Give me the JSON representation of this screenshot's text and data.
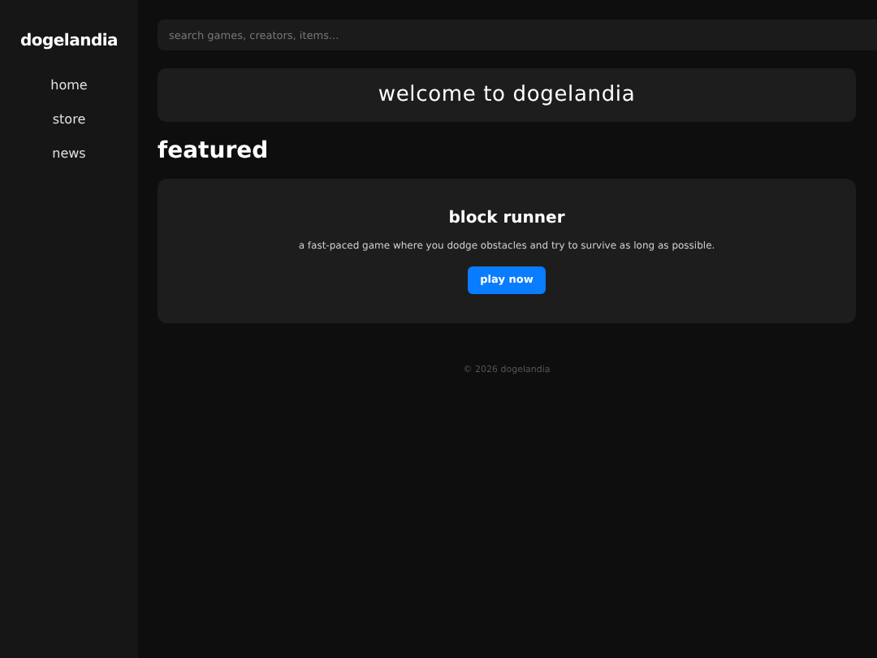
{
  "sidebar": {
    "logo": "dogelandia",
    "items": [
      {
        "label": "home"
      },
      {
        "label": "store"
      },
      {
        "label": "news"
      }
    ]
  },
  "search": {
    "placeholder": "search games, creators, items..."
  },
  "welcome": {
    "title": "welcome to dogelandia"
  },
  "featured": {
    "heading": "featured",
    "title": "block runner",
    "description": "a fast-paced game where you dodge obstacles and try to survive as long as possible.",
    "button": "play now"
  },
  "footer": "© 2026 dogelandia"
}
